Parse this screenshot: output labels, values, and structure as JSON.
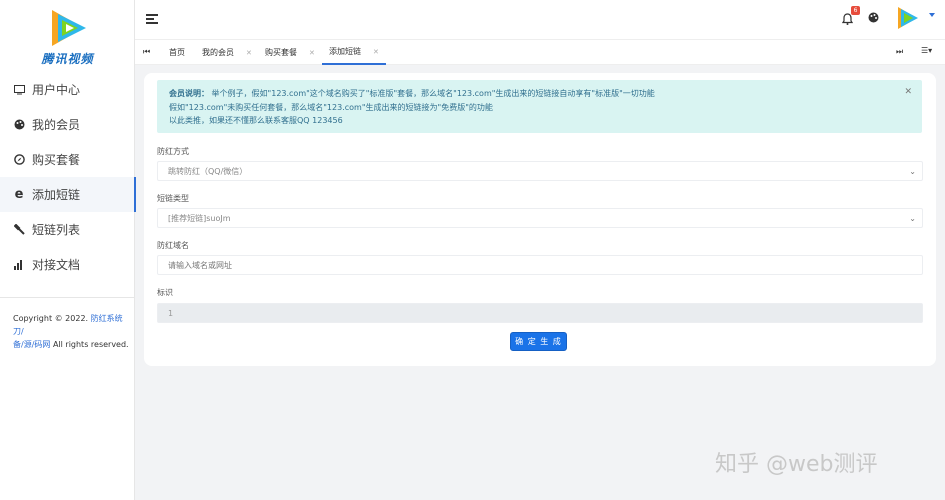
{
  "sidebar": {
    "logo_text": "腾讯视频",
    "items": [
      {
        "label": "用户中心",
        "icon": "monitor-icon"
      },
      {
        "label": "我的会员",
        "icon": "palette-icon"
      },
      {
        "label": "购买套餐",
        "icon": "compass-icon"
      },
      {
        "label": "添加短链",
        "icon": "ie-icon"
      },
      {
        "label": "短链列表",
        "icon": "wrench-icon"
      },
      {
        "label": "对接文档",
        "icon": "bar-chart-icon"
      }
    ],
    "active_index": 3,
    "copyright_prefix": "Copyright © 2022.",
    "copyright_link": "防红系统刀/",
    "copyright_link2": "备/源/码网",
    "copyright_suffix": "All rights reserved."
  },
  "topbar": {
    "badge_count": "6"
  },
  "tabs": {
    "items": [
      {
        "label": "首页"
      },
      {
        "label": "我的会员"
      },
      {
        "label": "购买套餐"
      },
      {
        "label": "添加短链"
      }
    ],
    "active_index": 3
  },
  "notice": {
    "title": "会员说明：",
    "line1": "举个例子，假如\"123.com\"这个域名购买了\"标准版\"套餐，那么域名\"123.com\"生成出来的短链接自动享有\"标准版\"一切功能",
    "line2": "假如\"123.com\"未购买任何套餐，那么域名\"123.com\"生成出来的短链接为\"免费版\"的功能",
    "line3": "以此类推，如果还不懂那么联系客服QQ 123456"
  },
  "form": {
    "anti_red_label": "防红方式",
    "anti_red_value": "跳转防红（QQ/微信）",
    "short_type_label": "短链类型",
    "short_type_value": "[推荐短链]suoJm",
    "domain_label": "防红域名",
    "domain_placeholder": "请输入域名或网址",
    "tag_label": "标识",
    "tag_value": "1",
    "submit_label": "确 定 生 成"
  },
  "watermark": "知乎 @web测评"
}
